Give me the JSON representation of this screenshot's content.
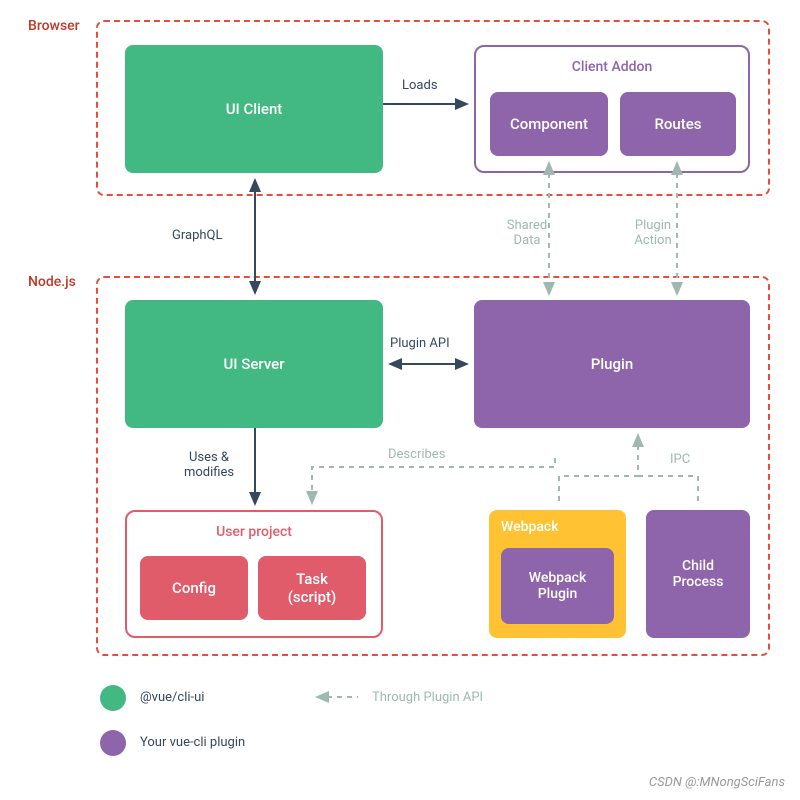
{
  "regions": {
    "browser": "Browser",
    "nodejs": "Node.js"
  },
  "nodes": {
    "uiClient": "UI Client",
    "uiServer": "UI Server",
    "clientAddon": "Client Addon",
    "component": "Component",
    "routes": "Routes",
    "plugin": "Plugin",
    "userProject": "User project",
    "config": "Config",
    "task": "Task\n(script)",
    "webpack": "Webpack",
    "webpackPlugin": "Webpack\nPlugin",
    "childProcess": "Child\nProcess"
  },
  "edges": {
    "loads": "Loads",
    "graphql": "GraphQL",
    "pluginApi": "Plugin API",
    "usesModifies": "Uses &\nmodifies",
    "sharedData": "Shared\nData",
    "pluginAction": "Plugin\nAction",
    "describes": "Describes",
    "ipc": "IPC"
  },
  "legend": {
    "green": "@vue/cli-ui",
    "purple": "Your vue-cli plugin",
    "dashed": "Through Plugin API"
  },
  "watermark": "CSDN @:MNongSciFans"
}
